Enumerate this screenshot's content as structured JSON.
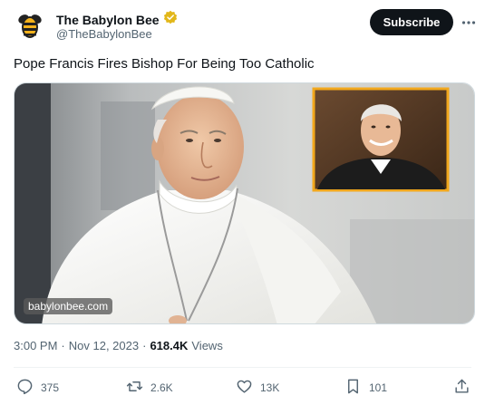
{
  "author": {
    "display_name": "The Babylon Bee",
    "handle": "@TheBabylonBee",
    "avatar_icon": "bee-logo-icon",
    "verified_icon": "gold-verified-badge-icon",
    "verified_color": "#e2b719"
  },
  "subscribe_label": "Subscribe",
  "more_icon": "more-horizontal-icon",
  "tweet_text": "Pope Francis Fires Bishop For Being Too Catholic",
  "media": {
    "watermark": "babylonbee.com",
    "inset_border_color": "#f2a81d"
  },
  "meta": {
    "time": "3:00 PM",
    "separator": "·",
    "date": "Nov 12, 2023",
    "views_count": "618.4K",
    "views_label": "Views"
  },
  "actions": {
    "reply": {
      "icon": "reply-icon",
      "count": "375"
    },
    "retweet": {
      "icon": "retweet-icon",
      "count": "2.6K"
    },
    "like": {
      "icon": "heart-icon",
      "count": "13K"
    },
    "bookmark": {
      "icon": "bookmark-icon",
      "count": "101"
    },
    "share": {
      "icon": "share-icon"
    }
  }
}
